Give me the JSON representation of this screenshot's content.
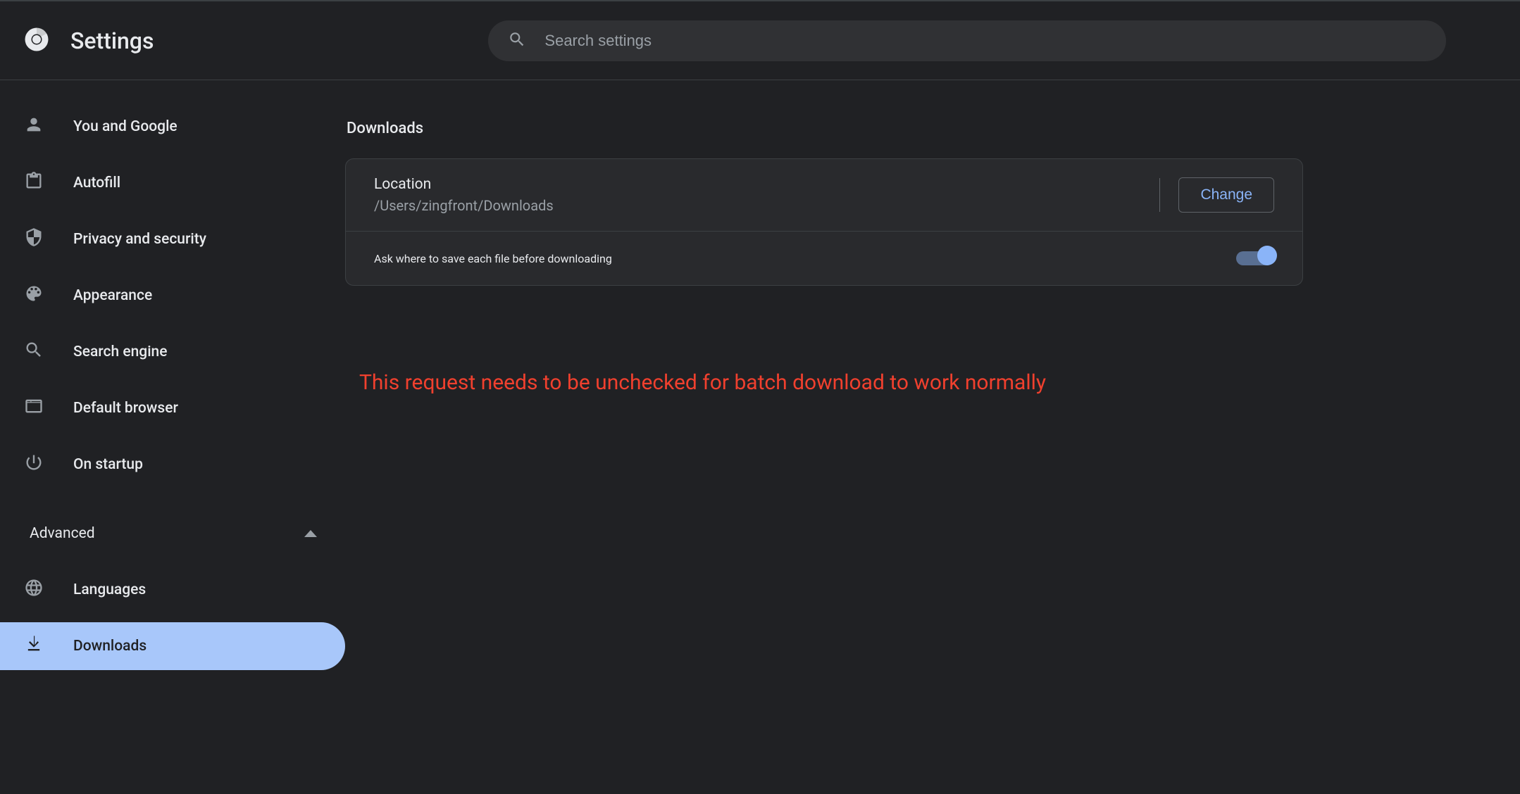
{
  "header": {
    "title": "Settings",
    "search_placeholder": "Search settings"
  },
  "sidebar": {
    "items": [
      {
        "id": "you-and-google",
        "label": "You and Google"
      },
      {
        "id": "autofill",
        "label": "Autofill"
      },
      {
        "id": "privacy",
        "label": "Privacy and security"
      },
      {
        "id": "appearance",
        "label": "Appearance"
      },
      {
        "id": "search-engine",
        "label": "Search engine"
      },
      {
        "id": "default-browser",
        "label": "Default browser"
      },
      {
        "id": "on-startup",
        "label": "On startup"
      }
    ],
    "advanced_label": "Advanced",
    "advanced_items": [
      {
        "id": "languages",
        "label": "Languages"
      },
      {
        "id": "downloads",
        "label": "Downloads",
        "active": true
      }
    ]
  },
  "main": {
    "section_title": "Downloads",
    "location": {
      "label": "Location",
      "path": "/Users/zingfront/Downloads",
      "button": "Change"
    },
    "ask_where": {
      "label": "Ask where to save each file before downloading",
      "enabled": true
    },
    "warning_text": "This request needs to be unchecked for batch download to work normally"
  },
  "colors": {
    "accent": "#8ab4f8",
    "active_bg": "#a8c7fa",
    "warning": "#f0402e"
  }
}
